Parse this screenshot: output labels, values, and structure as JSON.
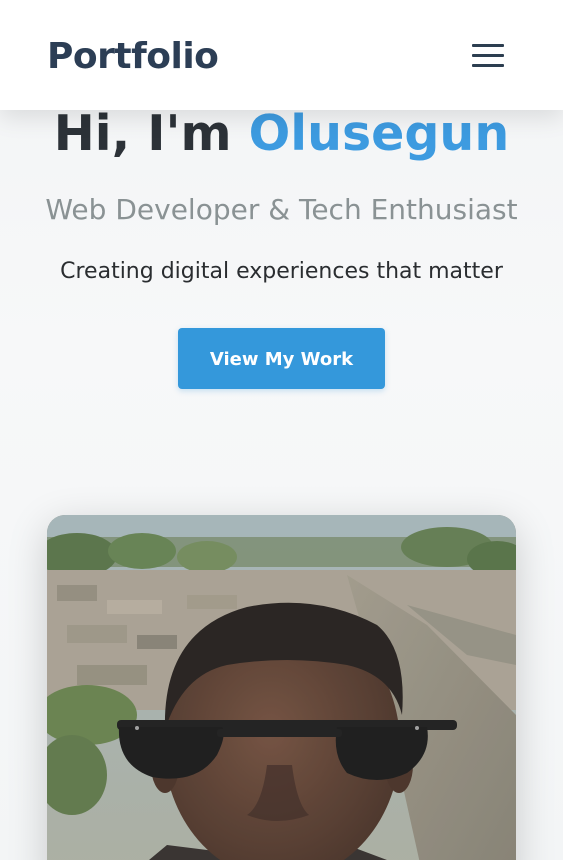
{
  "header": {
    "logo": "Portfolio",
    "menu_icon": "hamburger-menu-icon"
  },
  "hero": {
    "greeting": "Hi, I'm ",
    "name": "Olusegun",
    "subtitle": "Web Developer & Tech Enthusiast",
    "tagline": "Creating digital experiences that matter",
    "cta_label": "View My Work"
  },
  "colors": {
    "accent": "#3498db",
    "name_color": "#3d9be0",
    "logo_color": "#2c3e55",
    "text_dark": "#2c3238",
    "text_muted": "#8a9294"
  },
  "profile_photo": {
    "alt": "Olusegun"
  }
}
